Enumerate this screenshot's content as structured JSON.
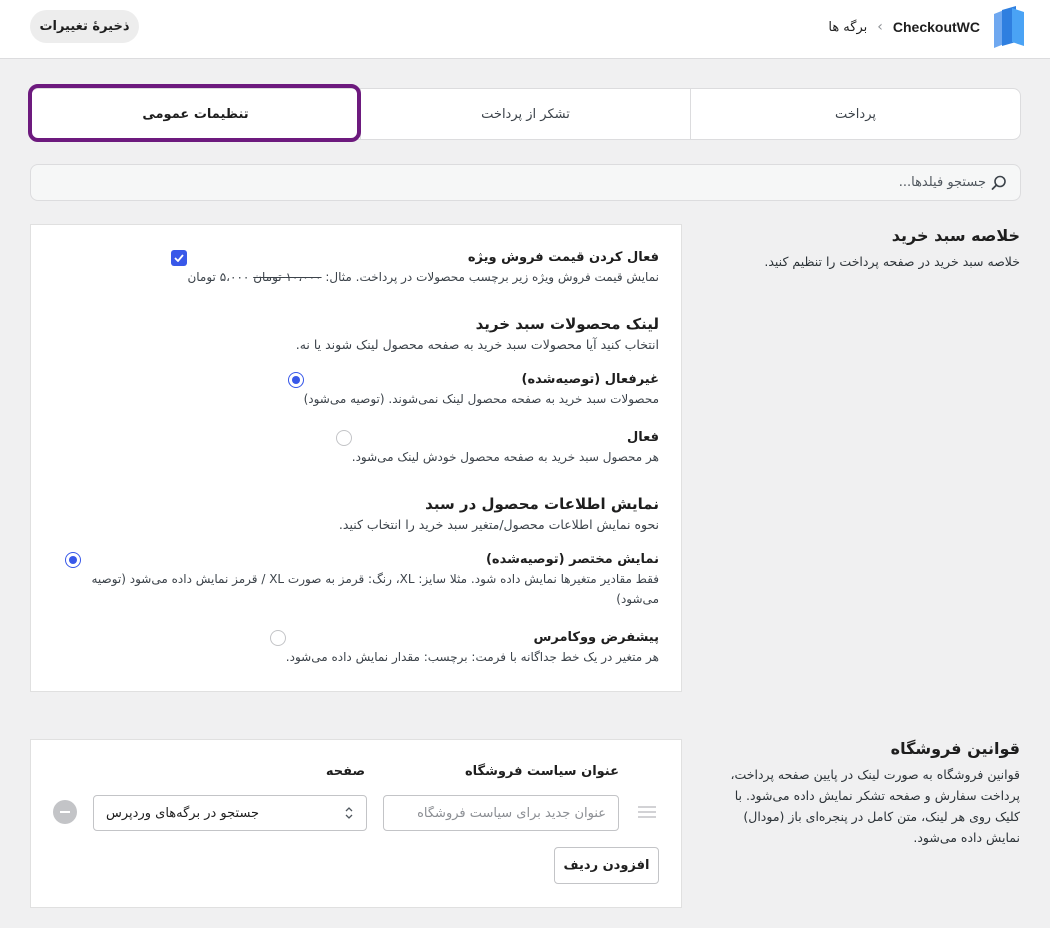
{
  "header": {
    "save_label": "ذخیرهٔ تغییرات",
    "brand": "CheckoutWC",
    "breadcrumb_separator": "‹",
    "breadcrumb_page": "برگه ها"
  },
  "tabs": [
    {
      "label": "پرداخت",
      "active": false
    },
    {
      "label": "تشکر از پرداخت",
      "active": false
    },
    {
      "label": "تنظیمات عمومی",
      "active": true
    }
  ],
  "search": {
    "placeholder": "جستجو فیلدها..."
  },
  "cart_summary": {
    "title": "خلاصه سبد خرید",
    "description": "خلاصه سبد خرید در صفحه پرداخت را تنظیم کنید.",
    "sale_price": {
      "label": "فعال کردن قیمت فروش ویژه",
      "desc_prefix": "نمایش قیمت فروش ویژه زیر برچسب محصولات در پرداخت. مثال: ",
      "desc_old": "۱۰،۰۰۰ تومان",
      "desc_new": " ۵،۰۰۰ تومان",
      "checked": true
    },
    "link_group": {
      "title": "لینک محصولات سبد خرید",
      "description": "انتخاب کنید آیا محصولات سبد خرید به صفحه محصول لینک شوند یا نه.",
      "options": [
        {
          "label": "غیرفعال (توصیه‌شده)",
          "desc": "محصولات سبد خرید به صفحه محصول لینک نمی‌شوند. (توصیه می‌شود)",
          "selected": true
        },
        {
          "label": "فعال",
          "desc": "هر محصول سبد خرید به صفحه محصول خودش لینک می‌شود.",
          "selected": false
        }
      ]
    },
    "info_group": {
      "title": "نمایش اطلاعات محصول در سبد",
      "description": "نحوه نمایش اطلاعات محصول/متغیر سبد خرید را انتخاب کنید.",
      "options": [
        {
          "label": "نمایش مختصر (توصیه‌شده)",
          "desc": "فقط مقادیر متغیرها نمایش داده شود. مثلا سایز: XL، رنگ: قرمز به صورت XL / قرمز نمایش داده می‌شود (توصیه می‌شود)",
          "selected": true
        },
        {
          "label": "پیشفرض ووکامرس",
          "desc": "هر متغیر در یک خط جداگانه با فرمت: برچسب: مقدار نمایش داده می‌شود.",
          "selected": false
        }
      ]
    }
  },
  "store_policies": {
    "title": "قوانین فروشگاه",
    "description": "قوانین فروشگاه به صورت لینک در پایین صفحه پرداخت، پرداخت سفارش و صفحه تشکر نمایش داده می‌شود. با کلیک روی هر لینک، متن کامل در پنجره‌ای باز (مودال) نمایش داده می‌شود.",
    "col_title": "عنوان سیاست فروشگاه",
    "col_page": "صفحه",
    "title_placeholder": "عنوان جدید برای سیاست فروشگاه",
    "page_select_value": "جستجو در برگه‌های وردپرس",
    "add_row_label": "افزودن ردیف"
  },
  "colors": {
    "accent": "#3858e9",
    "highlight": "#6d1a7e",
    "background": "#f0f0f1"
  }
}
